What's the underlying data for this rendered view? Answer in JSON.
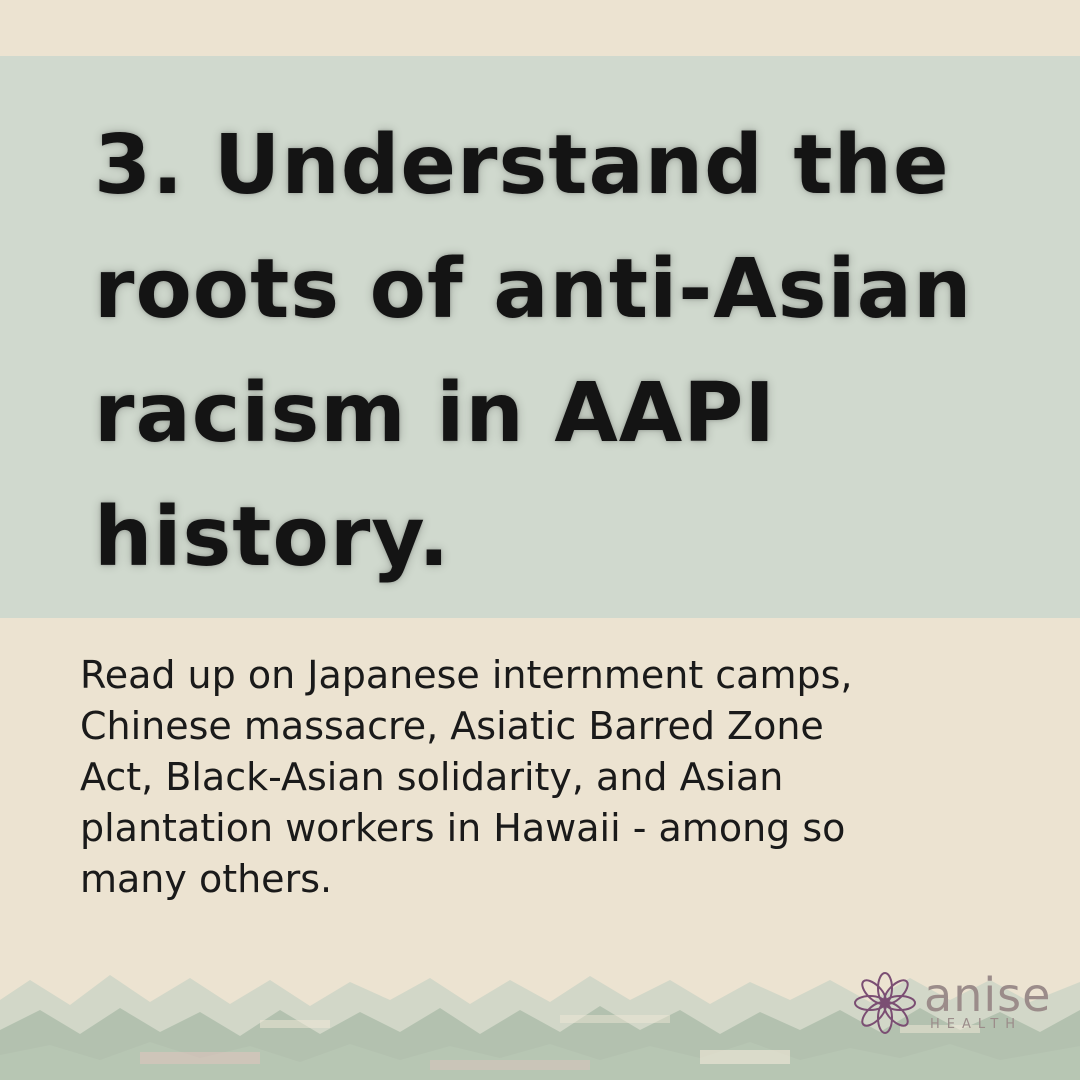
{
  "title": {
    "lines": [
      "3. Understand the",
      "roots of anti-Asian",
      "racism in AAPI",
      "history."
    ]
  },
  "body": {
    "lines": [
      "Read up on Japanese internment camps,",
      "Chinese massacre, Asiatic Barred Zone",
      "Act, Black-Asian solidarity, and Asian",
      "plantation workers in Hawaii - among so",
      "many others."
    ]
  },
  "logo": {
    "word": "anise",
    "sub": "HEALTH",
    "icon": "lotus-flower-icon"
  },
  "colors": {
    "background": "#ece3d1",
    "title_panel": "#d0d9ce",
    "text": "#141414",
    "logo": "#9b8c8a",
    "logo_icon": "#7b4e73"
  }
}
